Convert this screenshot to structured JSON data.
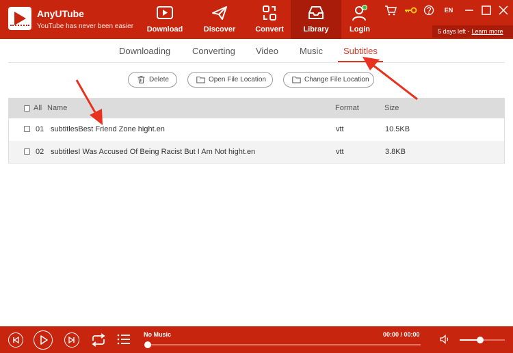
{
  "app": {
    "name": "AnyUTube",
    "slogan": "YouTube has never been easier"
  },
  "nav": {
    "items": [
      {
        "label": "Download",
        "icon": "play-box-icon"
      },
      {
        "label": "Discover",
        "icon": "paper-plane-icon"
      },
      {
        "label": "Convert",
        "icon": "convert-icon"
      },
      {
        "label": "Library",
        "icon": "inbox-icon",
        "active": true
      },
      {
        "label": "Login",
        "icon": "user-icon"
      }
    ]
  },
  "toolbar": {
    "lang": "EN",
    "icons": [
      "cart-icon",
      "key-icon",
      "help-icon",
      "minimize-icon",
      "maximize-icon",
      "close-icon"
    ]
  },
  "trial": {
    "text": "5 days left -",
    "link": "Learn more"
  },
  "tabs": {
    "items": [
      {
        "label": "Downloading"
      },
      {
        "label": "Converting"
      },
      {
        "label": "Video"
      },
      {
        "label": "Music"
      },
      {
        "label": "Subtitles",
        "active": true
      }
    ]
  },
  "actions": {
    "delete": "Delete",
    "open_location": "Open File Location",
    "change_location": "Change File Location"
  },
  "table": {
    "headers": {
      "all": "All",
      "name": "Name",
      "format": "Format",
      "size": "Size"
    },
    "rows": [
      {
        "index": "01",
        "name": "subtitlesBest Friend Zone hight.en",
        "format": "vtt",
        "size": "10.5KB"
      },
      {
        "index": "02",
        "name": "subtitlesI Was Accused Of Being Racist But I Am Not hight.en",
        "format": "vtt",
        "size": "3.8KB"
      }
    ]
  },
  "player": {
    "title": "No Music",
    "time": "00:00 / 00:00",
    "progress": 0,
    "volume": 0.45
  },
  "colors": {
    "brand": "#c8250f",
    "brand_dark": "#a81c09",
    "accent_tab": "#d33b24",
    "annotation_arrow": "#e8321f",
    "login_status_dot": "#3cc13c"
  }
}
